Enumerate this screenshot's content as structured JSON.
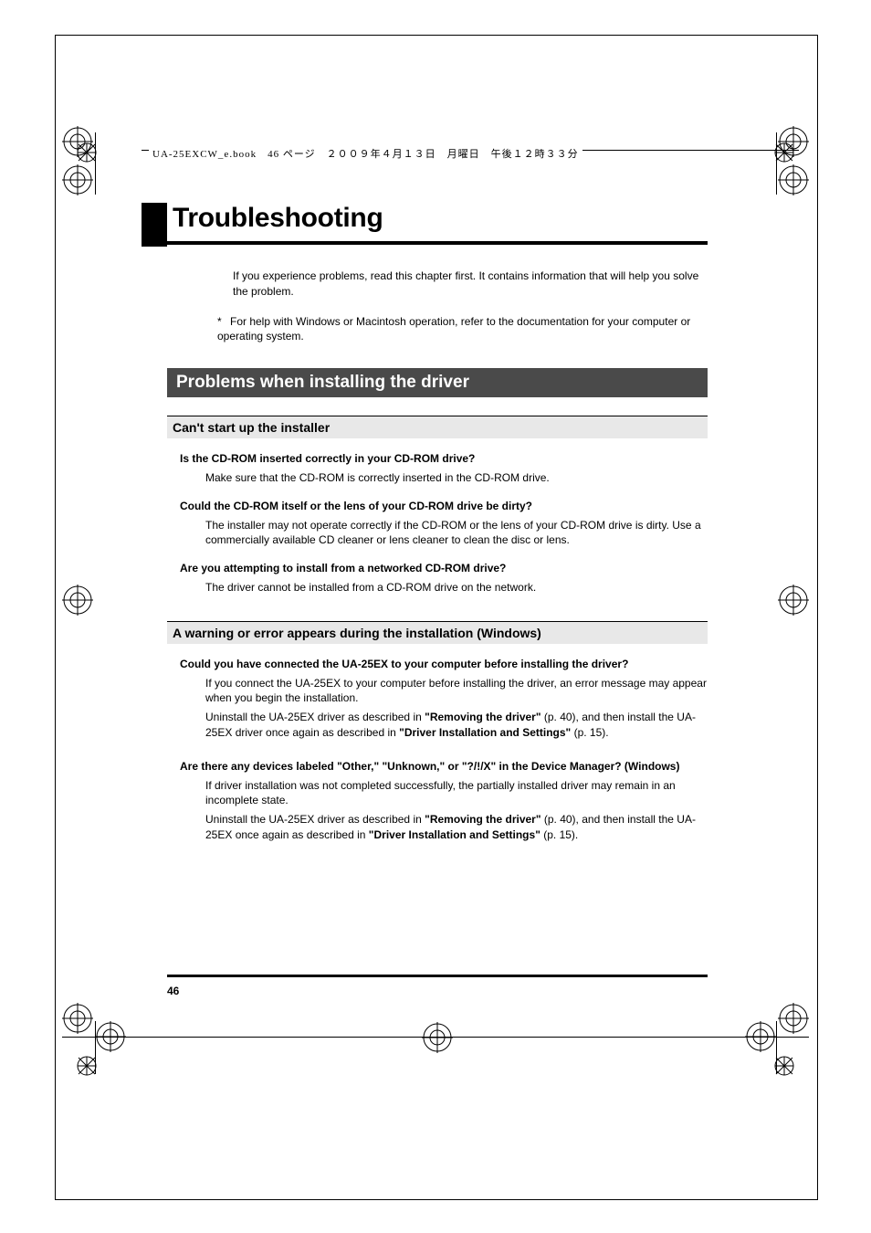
{
  "header": "UA-25EXCW_e.book　46 ページ　２００９年４月１３日　月曜日　午後１２時３３分",
  "title": "Troubleshooting",
  "intro": "If you experience problems, read this chapter first. It contains information that will help you solve the problem.",
  "note_star": "*",
  "note": "For help with Windows or Macintosh operation, refer to the documentation for your computer or operating system.",
  "section1": {
    "title": "Problems when installing the driver",
    "sub1": {
      "heading": "Can't start up the installer",
      "items": [
        {
          "q": "Is the CD-ROM inserted correctly in your CD-ROM drive?",
          "a": [
            "Make sure that the CD-ROM is correctly inserted in the CD-ROM drive."
          ]
        },
        {
          "q": "Could the CD-ROM itself or the lens of your CD-ROM drive be dirty?",
          "a": [
            "The installer may not operate correctly if the CD-ROM or the lens of your CD-ROM drive is dirty. Use a commercially available CD cleaner or lens cleaner to clean the disc or lens."
          ]
        },
        {
          "q": "Are you attempting to install from a networked CD-ROM drive?",
          "a": [
            "The driver cannot be installed from a CD-ROM drive on the network."
          ]
        }
      ]
    },
    "sub2": {
      "heading": "A warning or error appears during the installation (Windows)",
      "items": [
        {
          "q": "Could you have connected the UA-25EX to your computer before installing the driver?",
          "a_parts": [
            [
              {
                "t": "If you connect the UA-25EX to your computer before installing the driver, an error message may appear when you begin the installation."
              }
            ],
            [
              {
                "t": "Uninstall the UA-25EX driver as described in "
              },
              {
                "b": "\"Removing the driver\""
              },
              {
                "t": " (p. 40), and then install the UA-25EX driver once again as described in "
              },
              {
                "b": "\"Driver Installation and Settings\""
              },
              {
                "t": " (p. 15)."
              }
            ]
          ]
        },
        {
          "q": "Are there any devices labeled \"Other,\" \"Unknown,\" or \"?/!/X\" in the Device Manager? (Windows)",
          "a_parts": [
            [
              {
                "t": "If driver installation was not completed successfully, the partially installed driver may remain in an incomplete state."
              }
            ],
            [
              {
                "t": "Uninstall the UA-25EX driver as described in "
              },
              {
                "b": "\"Removing the driver\""
              },
              {
                "t": " (p. 40), and then install the UA-25EX once again as described in "
              },
              {
                "b": "\"Driver Installation and Settings\""
              },
              {
                "t": " (p. 15)."
              }
            ]
          ]
        }
      ]
    }
  },
  "page_number": "46"
}
